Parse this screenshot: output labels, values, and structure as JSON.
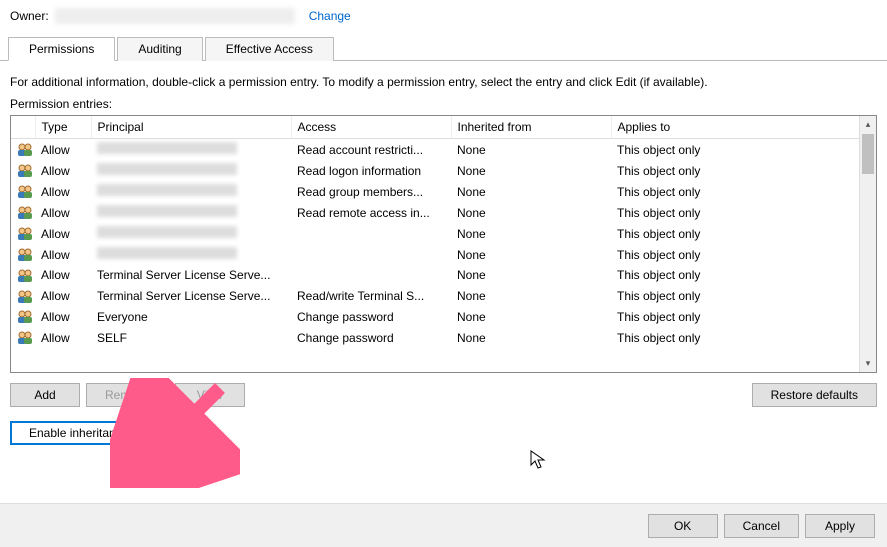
{
  "owner": {
    "label": "Owner:",
    "change": "Change"
  },
  "tabs": {
    "permissions": "Permissions",
    "auditing": "Auditing",
    "effective": "Effective Access"
  },
  "info": "For additional information, double-click a permission entry. To modify a permission entry, select the entry and click Edit (if available).",
  "entries_label": "Permission entries:",
  "columns": {
    "type": "Type",
    "principal": "Principal",
    "access": "Access",
    "inherited": "Inherited from",
    "applies": "Applies to"
  },
  "rows": [
    {
      "type": "Allow",
      "principal": "",
      "access": "Read account restricti...",
      "inherited": "None",
      "applies": "This object only",
      "blur": true
    },
    {
      "type": "Allow",
      "principal": "",
      "access": "Read logon information",
      "inherited": "None",
      "applies": "This object only",
      "blur": true
    },
    {
      "type": "Allow",
      "principal": "",
      "access": "Read group members...",
      "inherited": "None",
      "applies": "This object only",
      "blur": true
    },
    {
      "type": "Allow",
      "principal": "",
      "access": "Read remote access in...",
      "inherited": "None",
      "applies": "This object only",
      "blur": true
    },
    {
      "type": "Allow",
      "principal": "",
      "access": "",
      "inherited": "None",
      "applies": "This object only",
      "blur": true
    },
    {
      "type": "Allow",
      "principal": "",
      "access": "",
      "inherited": "None",
      "applies": "This object only",
      "blur": true
    },
    {
      "type": "Allow",
      "principal": "Terminal Server License Serve...",
      "access": "",
      "inherited": "None",
      "applies": "This object only",
      "blur": false
    },
    {
      "type": "Allow",
      "principal": "Terminal Server License Serve...",
      "access": "Read/write Terminal S...",
      "inherited": "None",
      "applies": "This object only",
      "blur": false
    },
    {
      "type": "Allow",
      "principal": "Everyone",
      "access": "Change password",
      "inherited": "None",
      "applies": "This object only",
      "blur": false
    },
    {
      "type": "Allow",
      "principal": "SELF",
      "access": "Change password",
      "inherited": "None",
      "applies": "This object only",
      "blur": false
    }
  ],
  "buttons": {
    "add": "Add",
    "remove": "Remove",
    "view": "View",
    "restore": "Restore defaults",
    "enable_inh": "Enable inheritance",
    "ok": "OK",
    "cancel": "Cancel",
    "apply": "Apply"
  }
}
